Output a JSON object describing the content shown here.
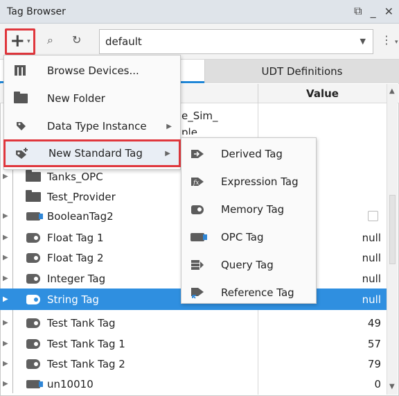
{
  "window": {
    "title": "Tag Browser",
    "controls": {
      "restore": "⧉",
      "minimize": "_",
      "close": "✕"
    }
  },
  "toolbar": {
    "add_glyph": "+",
    "add_caret": "▾",
    "search_glyph": "⌕",
    "refresh_glyph": "↻",
    "provider_value": "default",
    "provider_caret": "▼",
    "more_glyph": "⋮",
    "more_caret": "▾"
  },
  "tabs": {
    "udt_label": "UDT Definitions"
  },
  "columns": {
    "value": "Value"
  },
  "partial_text": {
    "line1": "e_Sim_",
    "line2": "ple"
  },
  "add_menu": {
    "items": [
      {
        "label": "Browse Devices...",
        "icon": "devices-icon"
      },
      {
        "label": "New Folder",
        "icon": "folder-icon"
      },
      {
        "label": "Data Type Instance",
        "icon": "data-type-icon",
        "submenu": "▶"
      },
      {
        "label": "New Standard Tag",
        "icon": "new-tag-icon",
        "submenu": "▶"
      }
    ]
  },
  "standard_tag_menu": {
    "items": [
      {
        "label": "Derived Tag",
        "icon": "derived-tag-icon"
      },
      {
        "label": "Expression Tag",
        "icon": "expression-tag-icon"
      },
      {
        "label": "Memory Tag",
        "icon": "memory-tag-icon"
      },
      {
        "label": "OPC Tag",
        "icon": "opc-tag-icon"
      },
      {
        "label": "Query Tag",
        "icon": "query-tag-icon"
      },
      {
        "label": "Reference Tag",
        "icon": "reference-tag-icon"
      }
    ]
  },
  "tree": {
    "rows": [
      {
        "label": "Tanks_OPC",
        "type": "folder",
        "value": ""
      },
      {
        "label": "Test_Provider",
        "type": "folder",
        "value": ""
      },
      {
        "label": "BooleanTag2",
        "type": "opc",
        "value": ""
      },
      {
        "label": "Float Tag 1",
        "type": "memory",
        "value": "null"
      },
      {
        "label": "Float Tag 2",
        "type": "memory",
        "value": "null"
      },
      {
        "label": "Integer Tag",
        "type": "memory",
        "value": "null"
      },
      {
        "label": "String Tag",
        "type": "memory",
        "value": "null"
      },
      {
        "label": "Test Tank Tag",
        "type": "memory",
        "value": "49"
      },
      {
        "label": "Test Tank Tag 1",
        "type": "memory",
        "value": "57"
      },
      {
        "label": "Test Tank Tag 2",
        "type": "memory",
        "value": "79"
      },
      {
        "label": "un10010",
        "type": "opc",
        "value": "0"
      }
    ],
    "expand_glyph": "▶",
    "scroll_up": "▲",
    "scroll_down": "▼"
  }
}
